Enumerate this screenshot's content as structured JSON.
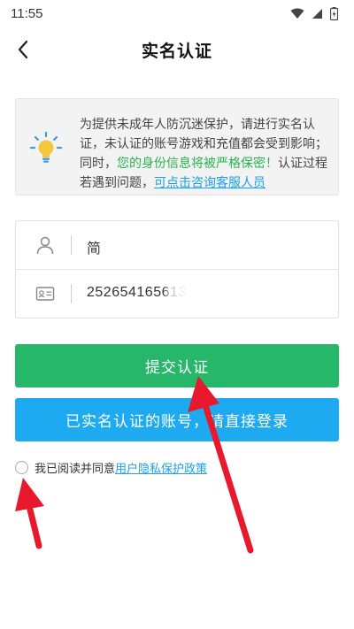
{
  "status_bar": {
    "time": "11:55",
    "icons": [
      "wifi-icon",
      "signal-icon",
      "battery-icon"
    ]
  },
  "header": {
    "title": "实名认证",
    "back_icon": "chevron-left-icon"
  },
  "notice": {
    "icon": "lightbulb-icon",
    "text_part1": "为提供未成年人防沉迷保护，请进行实名认证，未认证的账号游戏和充值都会受到影响；同时，",
    "text_highlight": "您的身份信息将被严格保密！",
    "text_part2": "认证过程若遇到问题，",
    "link_text": "可点击咨询客服人员"
  },
  "form": {
    "name_value": "简",
    "id_value": "252654165613",
    "name_icon": "person-icon",
    "id_icon": "id-card-icon"
  },
  "buttons": {
    "submit_label": "提交认证",
    "login_label": "已实名认证的账号，请直接登录"
  },
  "agreement": {
    "text": "我已阅读并同意",
    "link_text": "用户隐私保护政策"
  },
  "colors": {
    "submit": "#27b76a",
    "login": "#1eaaf0",
    "link": "#1aa0e8",
    "highlight": "#2bb14f",
    "annotation_arrow": "#e8192c"
  }
}
